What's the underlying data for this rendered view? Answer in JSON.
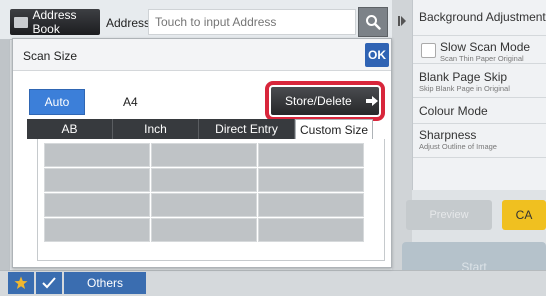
{
  "top_bar": {
    "address_book_label": "Address Book",
    "address_label": "Address",
    "address_placeholder": "Touch to input Address"
  },
  "dialog": {
    "title": "Scan Size",
    "ok_label": "OK",
    "auto_label": "Auto",
    "size_value": "A4",
    "store_delete_label": "Store/Delete",
    "tabs": [
      {
        "label": "AB",
        "active": false
      },
      {
        "label": "Inch",
        "active": false
      },
      {
        "label": "Direct Entry",
        "active": false
      },
      {
        "label": "Custom Size",
        "active": true
      }
    ]
  },
  "right_panel": {
    "items": [
      {
        "title": "Background Adjustment",
        "sub": ""
      },
      {
        "title": "Slow Scan Mode",
        "sub": "Scan Thin Paper Original"
      },
      {
        "title": "Blank Page Skip",
        "sub": "Skip Blank Page in Original"
      },
      {
        "title": "Colour Mode",
        "sub": ""
      },
      {
        "title": "Sharpness",
        "sub": "Adjust Outline of Image"
      }
    ]
  },
  "actions": {
    "preview_label": "Preview",
    "ca_label": "CA",
    "start_label": "Start"
  },
  "bottom_bar": {
    "others_label": "Others"
  },
  "colors": {
    "accent_blue": "#3c7fd9",
    "highlight_red": "#d8263b",
    "ca_yellow": "#f0c020"
  }
}
